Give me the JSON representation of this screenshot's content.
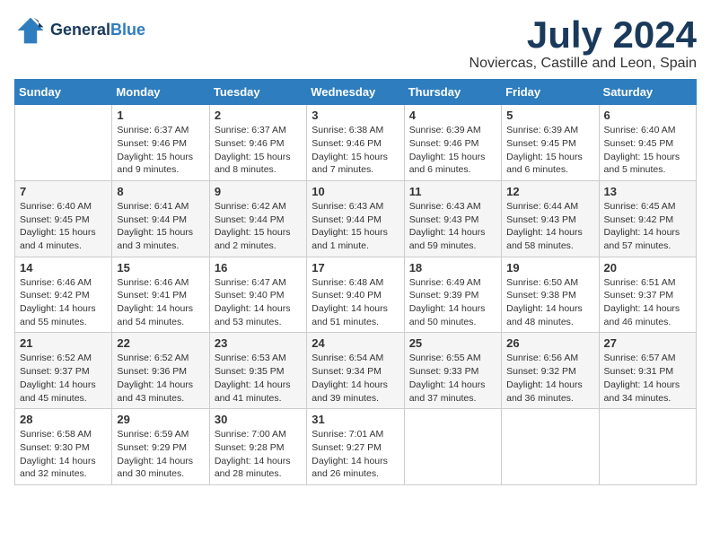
{
  "header": {
    "logo_line1": "General",
    "logo_line2": "Blue",
    "month_title": "July 2024",
    "location": "Noviercas, Castille and Leon, Spain"
  },
  "weekdays": [
    "Sunday",
    "Monday",
    "Tuesday",
    "Wednesday",
    "Thursday",
    "Friday",
    "Saturday"
  ],
  "weeks": [
    [
      {
        "day": "",
        "info": ""
      },
      {
        "day": "1",
        "info": "Sunrise: 6:37 AM\nSunset: 9:46 PM\nDaylight: 15 hours\nand 9 minutes."
      },
      {
        "day": "2",
        "info": "Sunrise: 6:37 AM\nSunset: 9:46 PM\nDaylight: 15 hours\nand 8 minutes."
      },
      {
        "day": "3",
        "info": "Sunrise: 6:38 AM\nSunset: 9:46 PM\nDaylight: 15 hours\nand 7 minutes."
      },
      {
        "day": "4",
        "info": "Sunrise: 6:39 AM\nSunset: 9:46 PM\nDaylight: 15 hours\nand 6 minutes."
      },
      {
        "day": "5",
        "info": "Sunrise: 6:39 AM\nSunset: 9:45 PM\nDaylight: 15 hours\nand 6 minutes."
      },
      {
        "day": "6",
        "info": "Sunrise: 6:40 AM\nSunset: 9:45 PM\nDaylight: 15 hours\nand 5 minutes."
      }
    ],
    [
      {
        "day": "7",
        "info": "Sunrise: 6:40 AM\nSunset: 9:45 PM\nDaylight: 15 hours\nand 4 minutes."
      },
      {
        "day": "8",
        "info": "Sunrise: 6:41 AM\nSunset: 9:44 PM\nDaylight: 15 hours\nand 3 minutes."
      },
      {
        "day": "9",
        "info": "Sunrise: 6:42 AM\nSunset: 9:44 PM\nDaylight: 15 hours\nand 2 minutes."
      },
      {
        "day": "10",
        "info": "Sunrise: 6:43 AM\nSunset: 9:44 PM\nDaylight: 15 hours\nand 1 minute."
      },
      {
        "day": "11",
        "info": "Sunrise: 6:43 AM\nSunset: 9:43 PM\nDaylight: 14 hours\nand 59 minutes."
      },
      {
        "day": "12",
        "info": "Sunrise: 6:44 AM\nSunset: 9:43 PM\nDaylight: 14 hours\nand 58 minutes."
      },
      {
        "day": "13",
        "info": "Sunrise: 6:45 AM\nSunset: 9:42 PM\nDaylight: 14 hours\nand 57 minutes."
      }
    ],
    [
      {
        "day": "14",
        "info": "Sunrise: 6:46 AM\nSunset: 9:42 PM\nDaylight: 14 hours\nand 55 minutes."
      },
      {
        "day": "15",
        "info": "Sunrise: 6:46 AM\nSunset: 9:41 PM\nDaylight: 14 hours\nand 54 minutes."
      },
      {
        "day": "16",
        "info": "Sunrise: 6:47 AM\nSunset: 9:40 PM\nDaylight: 14 hours\nand 53 minutes."
      },
      {
        "day": "17",
        "info": "Sunrise: 6:48 AM\nSunset: 9:40 PM\nDaylight: 14 hours\nand 51 minutes."
      },
      {
        "day": "18",
        "info": "Sunrise: 6:49 AM\nSunset: 9:39 PM\nDaylight: 14 hours\nand 50 minutes."
      },
      {
        "day": "19",
        "info": "Sunrise: 6:50 AM\nSunset: 9:38 PM\nDaylight: 14 hours\nand 48 minutes."
      },
      {
        "day": "20",
        "info": "Sunrise: 6:51 AM\nSunset: 9:37 PM\nDaylight: 14 hours\nand 46 minutes."
      }
    ],
    [
      {
        "day": "21",
        "info": "Sunrise: 6:52 AM\nSunset: 9:37 PM\nDaylight: 14 hours\nand 45 minutes."
      },
      {
        "day": "22",
        "info": "Sunrise: 6:52 AM\nSunset: 9:36 PM\nDaylight: 14 hours\nand 43 minutes."
      },
      {
        "day": "23",
        "info": "Sunrise: 6:53 AM\nSunset: 9:35 PM\nDaylight: 14 hours\nand 41 minutes."
      },
      {
        "day": "24",
        "info": "Sunrise: 6:54 AM\nSunset: 9:34 PM\nDaylight: 14 hours\nand 39 minutes."
      },
      {
        "day": "25",
        "info": "Sunrise: 6:55 AM\nSunset: 9:33 PM\nDaylight: 14 hours\nand 37 minutes."
      },
      {
        "day": "26",
        "info": "Sunrise: 6:56 AM\nSunset: 9:32 PM\nDaylight: 14 hours\nand 36 minutes."
      },
      {
        "day": "27",
        "info": "Sunrise: 6:57 AM\nSunset: 9:31 PM\nDaylight: 14 hours\nand 34 minutes."
      }
    ],
    [
      {
        "day": "28",
        "info": "Sunrise: 6:58 AM\nSunset: 9:30 PM\nDaylight: 14 hours\nand 32 minutes."
      },
      {
        "day": "29",
        "info": "Sunrise: 6:59 AM\nSunset: 9:29 PM\nDaylight: 14 hours\nand 30 minutes."
      },
      {
        "day": "30",
        "info": "Sunrise: 7:00 AM\nSunset: 9:28 PM\nDaylight: 14 hours\nand 28 minutes."
      },
      {
        "day": "31",
        "info": "Sunrise: 7:01 AM\nSunset: 9:27 PM\nDaylight: 14 hours\nand 26 minutes."
      },
      {
        "day": "",
        "info": ""
      },
      {
        "day": "",
        "info": ""
      },
      {
        "day": "",
        "info": ""
      }
    ]
  ]
}
